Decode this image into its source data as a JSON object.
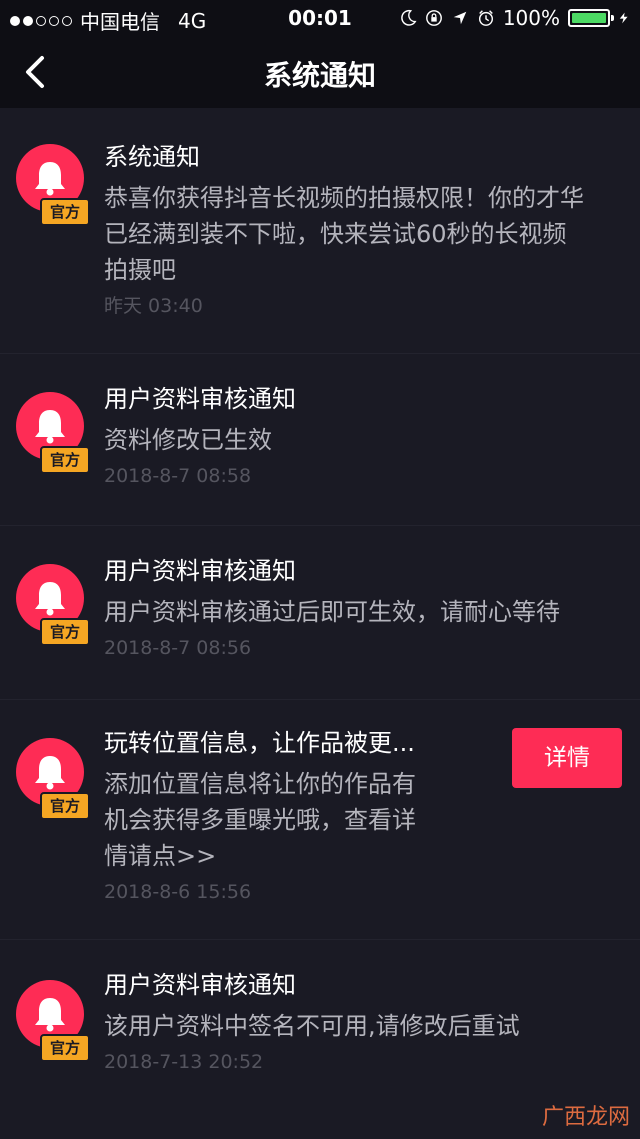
{
  "status_bar": {
    "carrier": "中国电信",
    "network": "4G",
    "time": "00:01",
    "battery": "100%",
    "battery_level": 1.0
  },
  "nav": {
    "title": "系统通知"
  },
  "badge_label": "官方",
  "colors": {
    "accent": "#fe2c55",
    "badge": "#f5a623",
    "background": "#1a1a24"
  },
  "notifications": [
    {
      "title": "系统通知",
      "body_lines": [
        "恭喜你获得抖音长视频的拍摄权限！你的才华",
        "已经满到装不下啦，快来尝试60秒的长视频",
        "拍摄吧"
      ],
      "time": "昨天 03:40"
    },
    {
      "title": "用户资料审核通知",
      "body_lines": [
        "资料修改已生效"
      ],
      "time": "2018-8-7 08:58"
    },
    {
      "title": "用户资料审核通知",
      "body_lines": [
        "用户资料审核通过后即可生效，请耐心等待"
      ],
      "time": "2018-8-7 08:56"
    },
    {
      "title": "玩转位置信息，让作品被更...",
      "body_lines": [
        "添加位置信息将让你的作品有",
        "机会获得多重曝光哦，查看详",
        "情请点>>"
      ],
      "time": "2018-8-6 15:56",
      "action_label": "详情"
    },
    {
      "title": "用户资料审核通知",
      "body_lines": [
        "该用户资料中签名不可用,请修改后重试"
      ],
      "time": "2018-7-13 20:52"
    }
  ],
  "watermark": "广西龙网"
}
